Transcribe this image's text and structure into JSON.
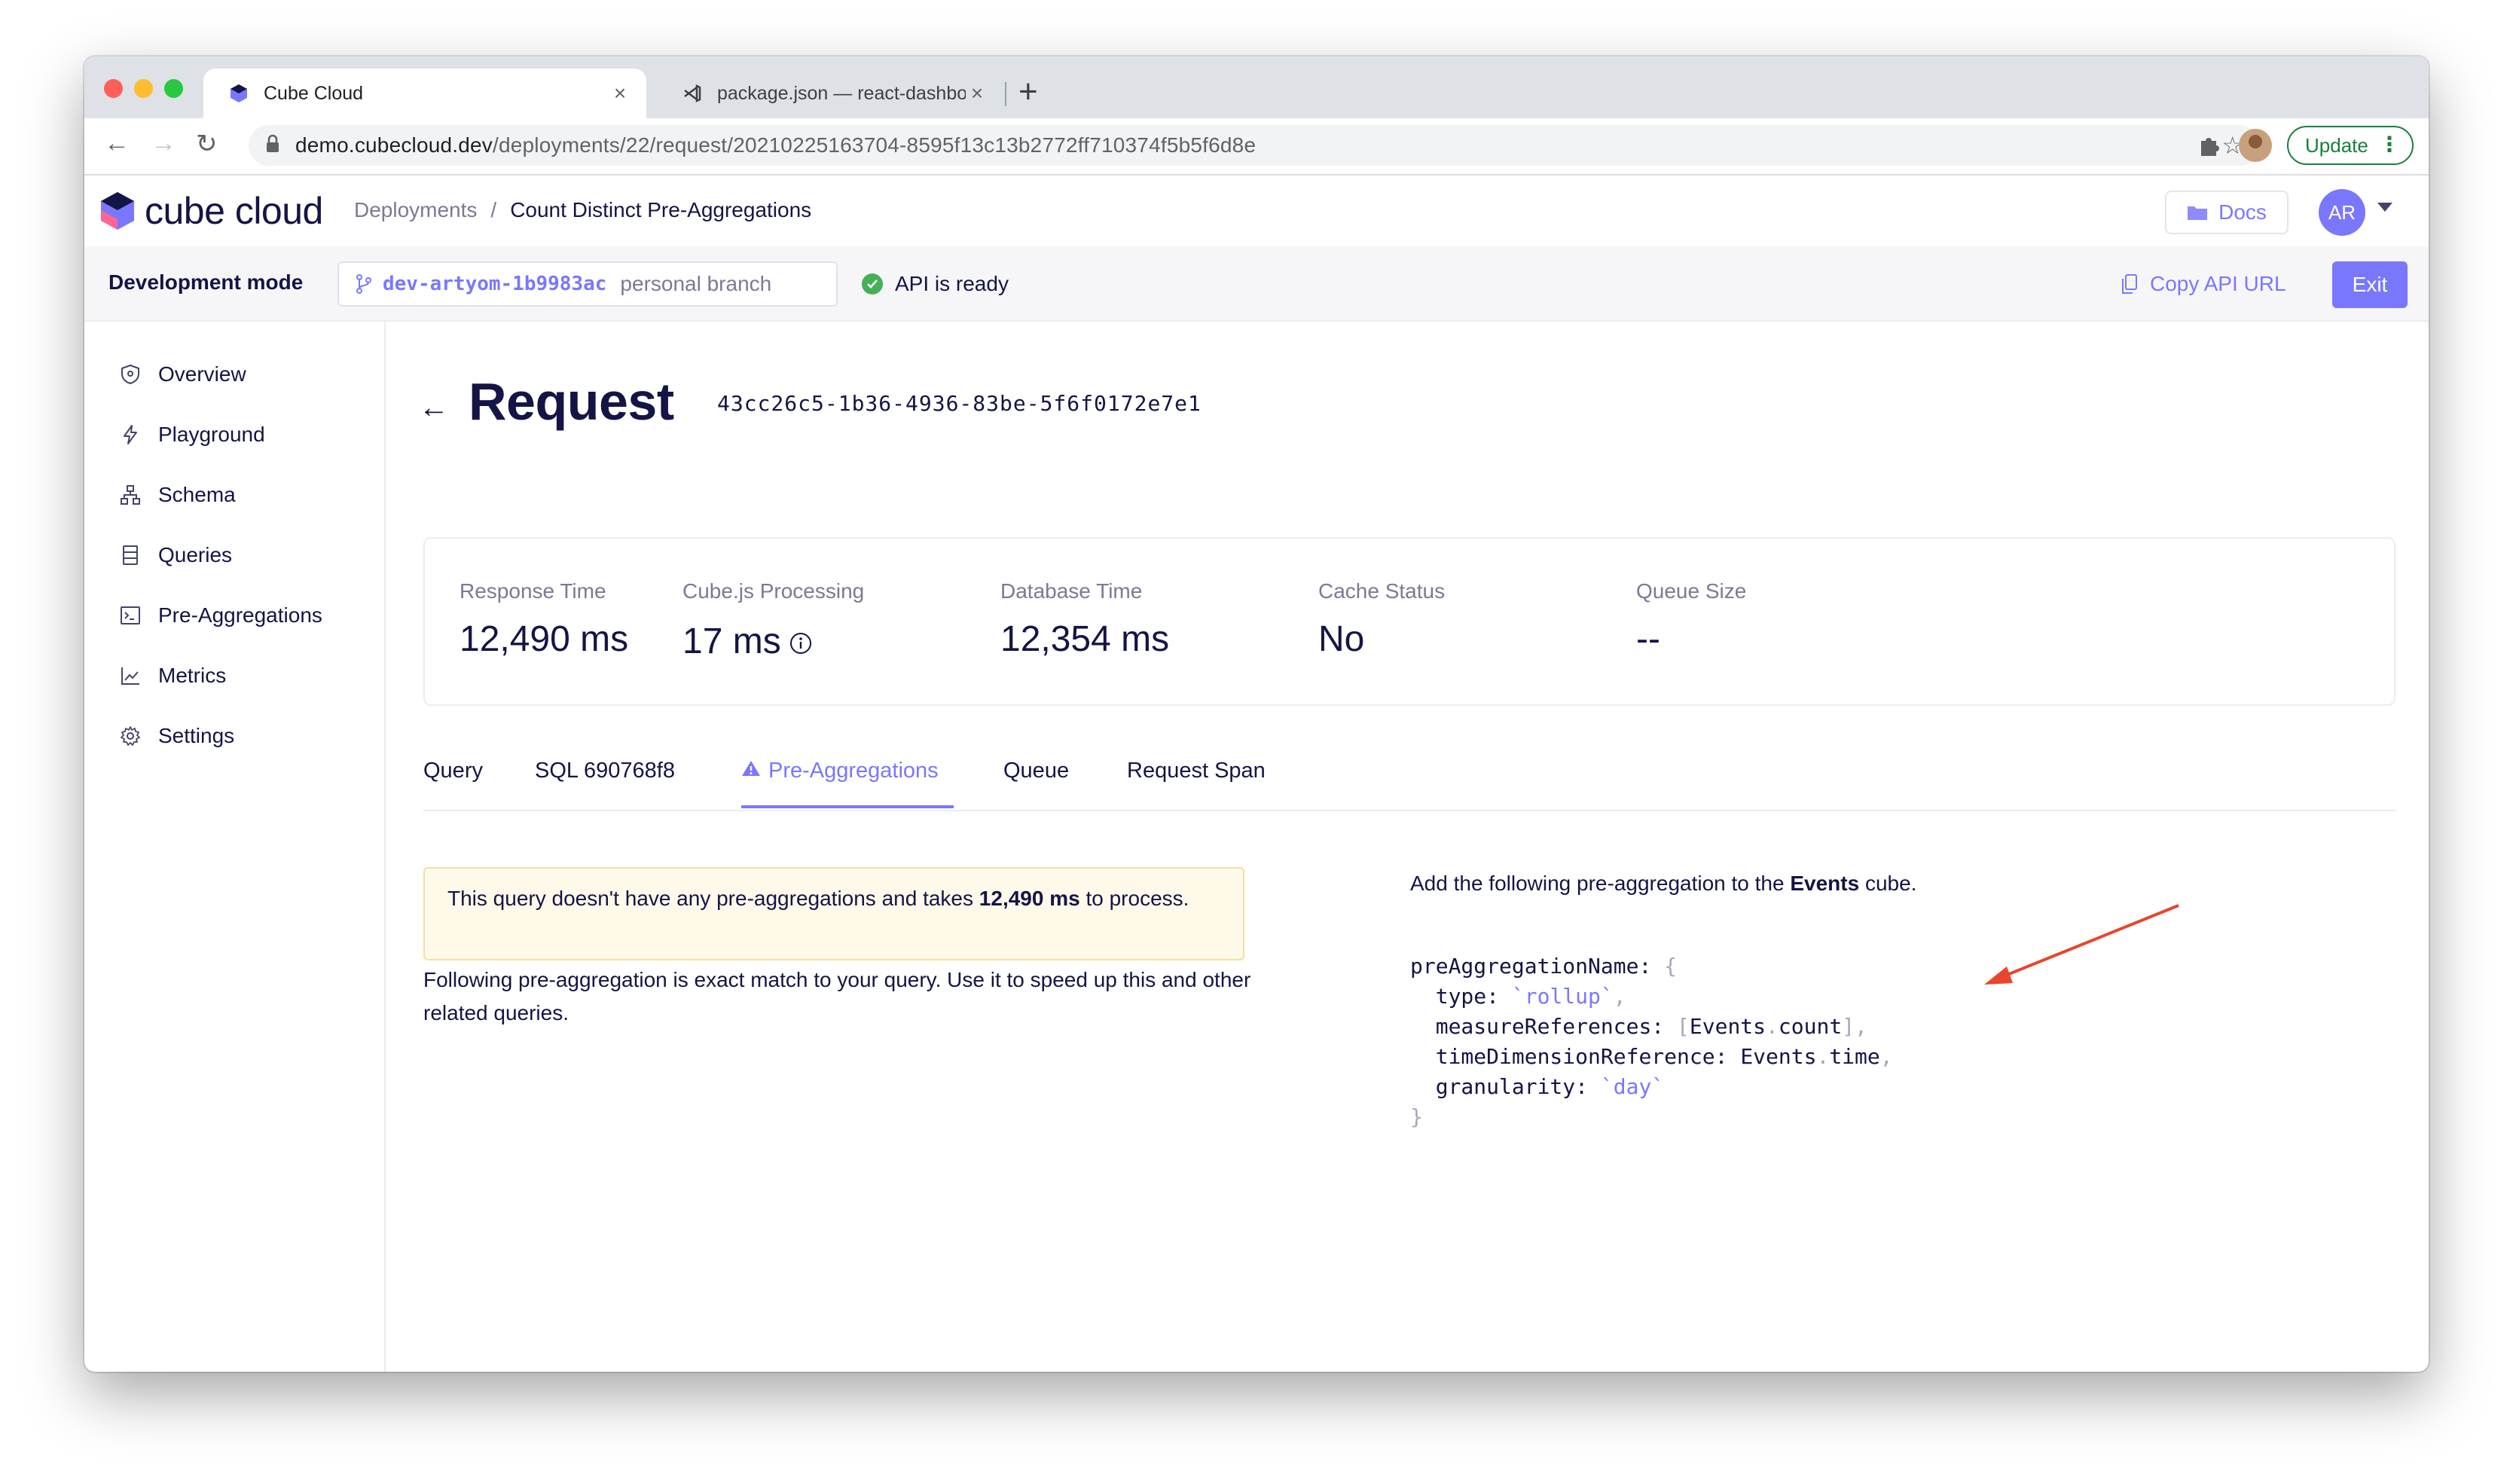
{
  "browser": {
    "tabs": [
      {
        "title": "Cube Cloud",
        "close": "×"
      },
      {
        "title": "package.json — react-dashboard",
        "close": "×"
      }
    ],
    "new_tab": "+",
    "url_host": "demo.cubecloud.dev",
    "url_path": "/deployments/22/request/20210225163704-8595f13c13b2772ff710374f5b5f6d8e",
    "update_label": "Update"
  },
  "header": {
    "logo_text": "cube cloud",
    "breadcrumb": [
      "Deployments",
      "Count Distinct Pre-Aggregations"
    ],
    "breadcrumb_sep": "/",
    "docs_label": "Docs",
    "avatar_initials": "AR"
  },
  "devbar": {
    "title": "Development mode",
    "branch_name": "dev-artyom-1b9983ac",
    "branch_type": "personal branch",
    "api_status": "API is ready",
    "copy_api_url": "Copy API URL",
    "exit_label": "Exit"
  },
  "sidebar": {
    "items": [
      {
        "label": "Overview",
        "icon": "shield-icon"
      },
      {
        "label": "Playground",
        "icon": "lightning-icon"
      },
      {
        "label": "Schema",
        "icon": "schema-icon"
      },
      {
        "label": "Queries",
        "icon": "list-icon"
      },
      {
        "label": "Pre-Aggregations",
        "icon": "terminal-icon"
      },
      {
        "label": "Metrics",
        "icon": "chart-icon"
      },
      {
        "label": "Settings",
        "icon": "gear-icon"
      }
    ]
  },
  "page": {
    "title": "Request",
    "request_id": "43cc26c5-1b36-4936-83be-5f6f0172e7e1",
    "stats": [
      {
        "label": "Response Time",
        "value": "12,490 ms"
      },
      {
        "label": "Cube.js Processing",
        "value": "17 ms"
      },
      {
        "label": "Database Time",
        "value": "12,354 ms"
      },
      {
        "label": "Cache Status",
        "value": "No"
      },
      {
        "label": "Queue Size",
        "value": "--"
      }
    ],
    "tabs": [
      "Query",
      "SQL 690768f8",
      "Pre-Aggregations",
      "Queue",
      "Request Span"
    ],
    "active_tab": "Pre-Aggregations",
    "alert": {
      "prefix": "This query doesn't have any pre-aggregations and takes ",
      "bold": "12,490 ms",
      "suffix": " to process."
    },
    "follow_text": "Following pre-aggregation is exact match to your query. Use it to speed up this and other related queries.",
    "add_text": {
      "prefix": "Add the following pre-aggregation to the ",
      "bold": "Events",
      "suffix": " cube."
    },
    "code": {
      "name": "preAggregationName",
      "type_key": "type",
      "type_val": "rollup",
      "measures_key": "measureReferences",
      "measures_val_cube": "Events",
      "measures_val_member": "count",
      "time_key": "timeDimensionReference",
      "time_val_cube": "Events",
      "time_val_member": "time",
      "gran_key": "granularity",
      "gran_val": "day"
    }
  },
  "colors": {
    "accent": "#7a77ff",
    "text": "#141446",
    "muted": "#7a7a94",
    "success": "#44b058",
    "annotation_arrow": "#e8452c",
    "alert_bg": "#fff9e9"
  }
}
